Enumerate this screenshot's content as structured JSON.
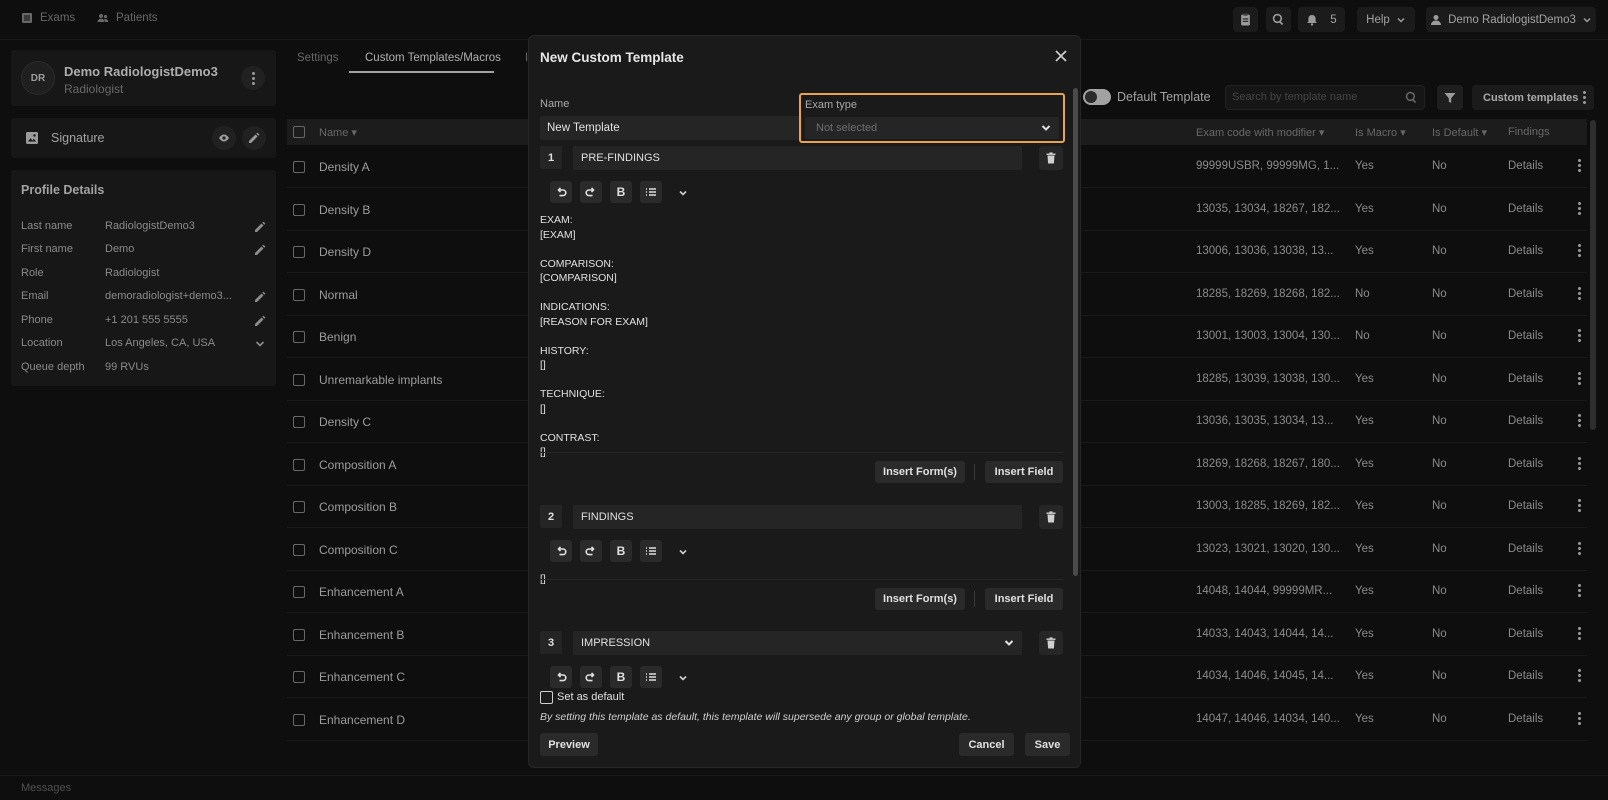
{
  "topbar": {
    "exams_label": "Exams",
    "patients_label": "Patients",
    "notifications_count": "5",
    "help_label": "Help",
    "user_label": "Demo RadiologistDemo3"
  },
  "user": {
    "initials": "DR",
    "name": "Demo RadiologistDemo3",
    "role": "Radiologist"
  },
  "signature": {
    "label": "Signature"
  },
  "profile": {
    "title": "Profile Details",
    "rows": [
      {
        "key": "Last name",
        "value": "RadiologistDemo3"
      },
      {
        "key": "First name",
        "value": "Demo"
      },
      {
        "key": "Role",
        "value": "Radiologist"
      },
      {
        "key": "Email",
        "value": "demoradiologist+demo3..."
      },
      {
        "key": "Phone",
        "value": "+1 201 555 5555"
      },
      {
        "key": "Location",
        "value": "Los Angeles, CA, USA"
      },
      {
        "key": "Queue depth",
        "value": "99 RVUs"
      }
    ]
  },
  "tabs": [
    {
      "label": "Settings"
    },
    {
      "label": "Custom Templates/Macros"
    },
    {
      "label": "I"
    }
  ],
  "toolbar": {
    "default_template_label": "Default Template",
    "search_placeholder": "Search by template name",
    "custom_templates_label": "Custom templates"
  },
  "table": {
    "headers": {
      "name": "Name",
      "exam_code": "Exam code with modifier",
      "is_macro": "Is Macro",
      "is_default": "Is Default",
      "findings": "Findings"
    },
    "rows": [
      {
        "name": "Density A",
        "code": "99999USBR, 99999MG, 1...",
        "macro": "Yes",
        "def": "No",
        "details": "Details"
      },
      {
        "name": "Density B",
        "code": "13035, 13034, 18267, 182...",
        "macro": "Yes",
        "def": "No",
        "details": "Details"
      },
      {
        "name": "Density D",
        "code": "13006, 13036, 13038, 13...",
        "macro": "Yes",
        "def": "No",
        "details": "Details"
      },
      {
        "name": "Normal",
        "code": "18285, 18269, 18268, 182...",
        "macro": "No",
        "def": "No",
        "details": "Details"
      },
      {
        "name": "Benign",
        "code": "13001, 13003, 13004, 130...",
        "macro": "No",
        "def": "No",
        "details": "Details"
      },
      {
        "name": "Unremarkable implants",
        "code": "18285, 13039, 13038, 130...",
        "macro": "Yes",
        "def": "No",
        "details": "Details"
      },
      {
        "name": "Density C",
        "code": "13036, 13035, 13034, 13...",
        "macro": "Yes",
        "def": "No",
        "details": "Details"
      },
      {
        "name": "Composition A",
        "code": "18269, 18268, 18267, 180...",
        "macro": "Yes",
        "def": "No",
        "details": "Details"
      },
      {
        "name": "Composition B",
        "code": "13003, 18285, 18269, 182...",
        "macro": "Yes",
        "def": "No",
        "details": "Details"
      },
      {
        "name": "Composition C",
        "code": "13023, 13021, 13020, 130...",
        "macro": "Yes",
        "def": "No",
        "details": "Details"
      },
      {
        "name": "Enhancement A",
        "code": "14048, 14044, 99999MR...",
        "macro": "Yes",
        "def": "No",
        "details": "Details"
      },
      {
        "name": "Enhancement B",
        "code": "14033, 14043, 14044, 14...",
        "macro": "Yes",
        "def": "No",
        "details": "Details"
      },
      {
        "name": "Enhancement C",
        "code": "14034, 14046, 14045, 14...",
        "macro": "Yes",
        "def": "No",
        "details": "Details"
      },
      {
        "name": "Enhancement D",
        "code": "14047, 14046, 14034, 140...",
        "macro": "Yes",
        "def": "No",
        "details": "Details"
      }
    ]
  },
  "footer": {
    "messages_label": "Messages"
  },
  "modal": {
    "title": "New Custom Template",
    "name_label": "Name",
    "name_value": "New Template",
    "exam_type_label": "Exam type",
    "exam_type_placeholder": "Not selected",
    "sections": [
      {
        "number": "1",
        "title": "PRE-FINDINGS",
        "content": "EXAM:\n[EXAM]\n\nCOMPARISON:\n[COMPARISON]\n\nINDICATIONS:\n[REASON FOR EXAM]\n\nHISTORY:\n[]\n\nTECHNIQUE:\n[]\n\nCONTRAST:\n[]"
      },
      {
        "number": "2",
        "title": "FINDINGS",
        "content": "[]"
      },
      {
        "number": "3",
        "title": "IMPRESSION",
        "content": ""
      }
    ],
    "insert_forms_label": "Insert Form(s)",
    "insert_field_label": "Insert Field",
    "set_default_label": "Set as default",
    "set_default_note": "By setting this template as default, this template will supersede any group or global template.",
    "preview_label": "Preview",
    "cancel_label": "Cancel",
    "save_label": "Save"
  },
  "colors": {
    "background": "#131313",
    "panel": "#1f1f1f",
    "modal": "#1a1a1a",
    "focus_outline": "#e8a34d"
  }
}
